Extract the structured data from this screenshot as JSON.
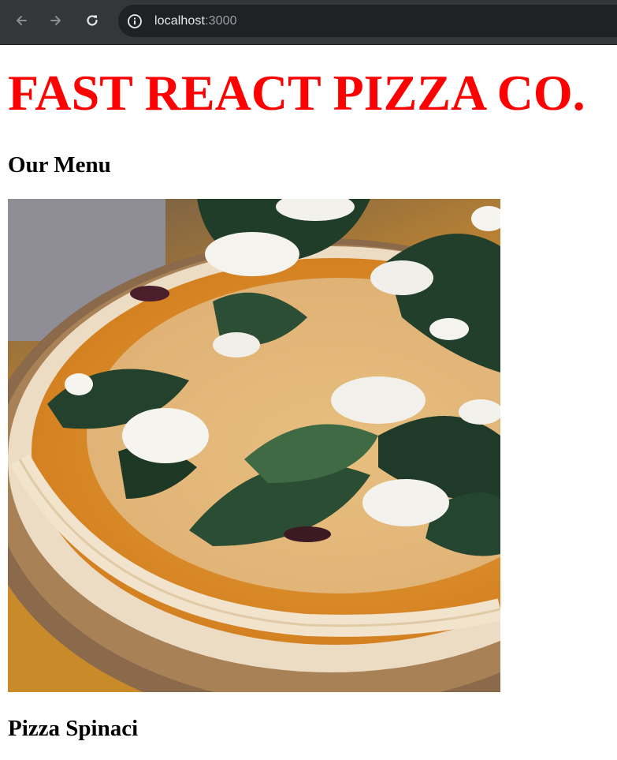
{
  "browser": {
    "address_host": "localhost",
    "address_port": ":3000"
  },
  "header": {
    "title": "FAST REACT PIZZA CO.",
    "title_color": "#ff0000"
  },
  "menu": {
    "heading": "Our Menu",
    "items": [
      {
        "name": "Pizza Spinaci"
      }
    ]
  }
}
